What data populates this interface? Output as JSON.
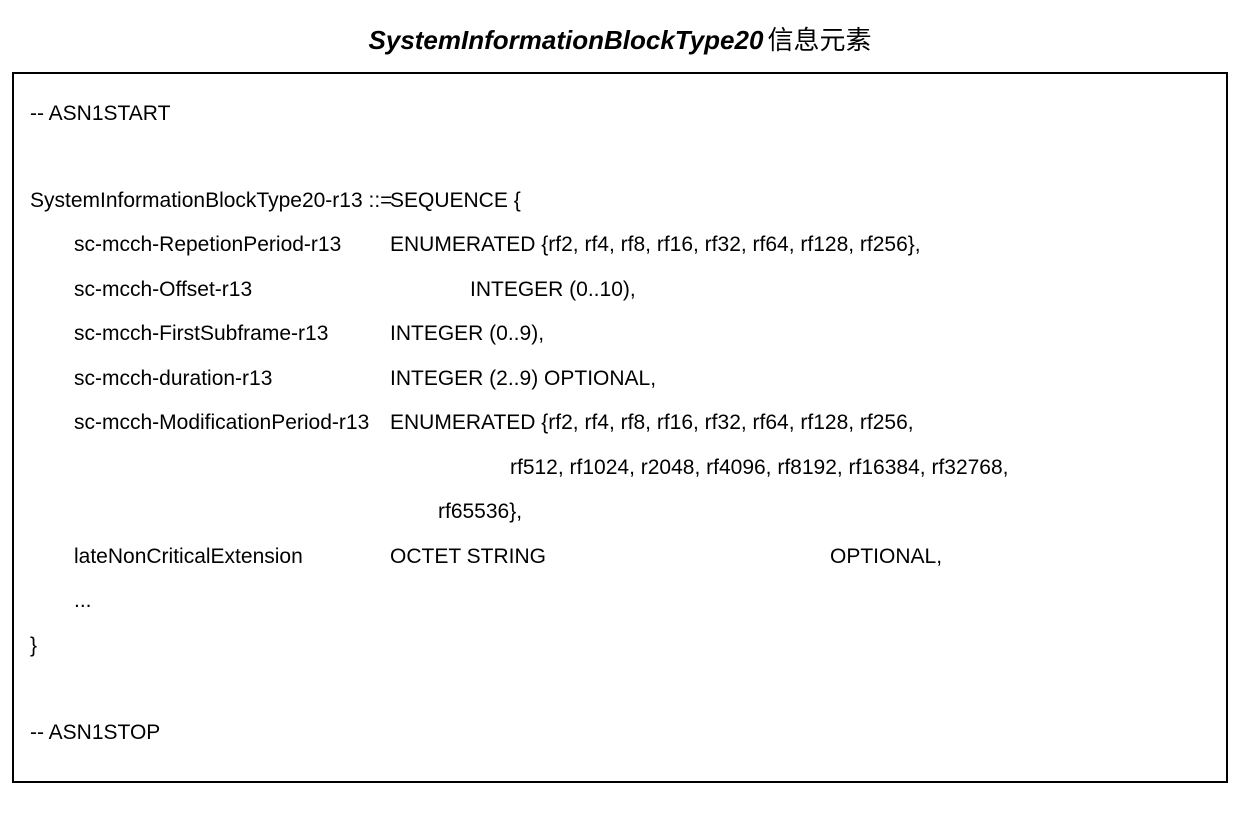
{
  "title": {
    "italic": "SystemInformationBlockType20",
    "cjk": "信息元素"
  },
  "asn": {
    "start": "-- ASN1START",
    "line1a": "SystemInformationBlockType20-r13 ::=",
    "line1b": "SEQUENCE {",
    "line2a": "sc-mcch-RepetionPeriod-r13",
    "line2b": "ENUMERATED {rf2, rf4, rf8, rf16, rf32, rf64, rf128, rf256},",
    "line3a": "sc-mcch-Offset-r13",
    "line3b": "INTEGER (0..10),",
    "line4a": "sc-mcch-FirstSubframe-r13",
    "line4b": "INTEGER (0..9),",
    "line5a": "sc-mcch-duration-r13",
    "line5b": "INTEGER (2..9) OPTIONAL,",
    "line6a": "sc-mcch-ModificationPeriod-r13",
    "line6b": "ENUMERATED {rf2, rf4, rf8, rf16, rf32, rf64, rf128, rf256,",
    "line7": "rf512, rf1024, r2048, rf4096, rf8192, rf16384, rf32768,",
    "line8": "rf65536},",
    "line9a": "lateNonCriticalExtension",
    "line9b": "OCTET STRING",
    "line9c": "OPTIONAL,",
    "line10": "...",
    "closebrace": "}",
    "stop": "-- ASN1STOP"
  }
}
